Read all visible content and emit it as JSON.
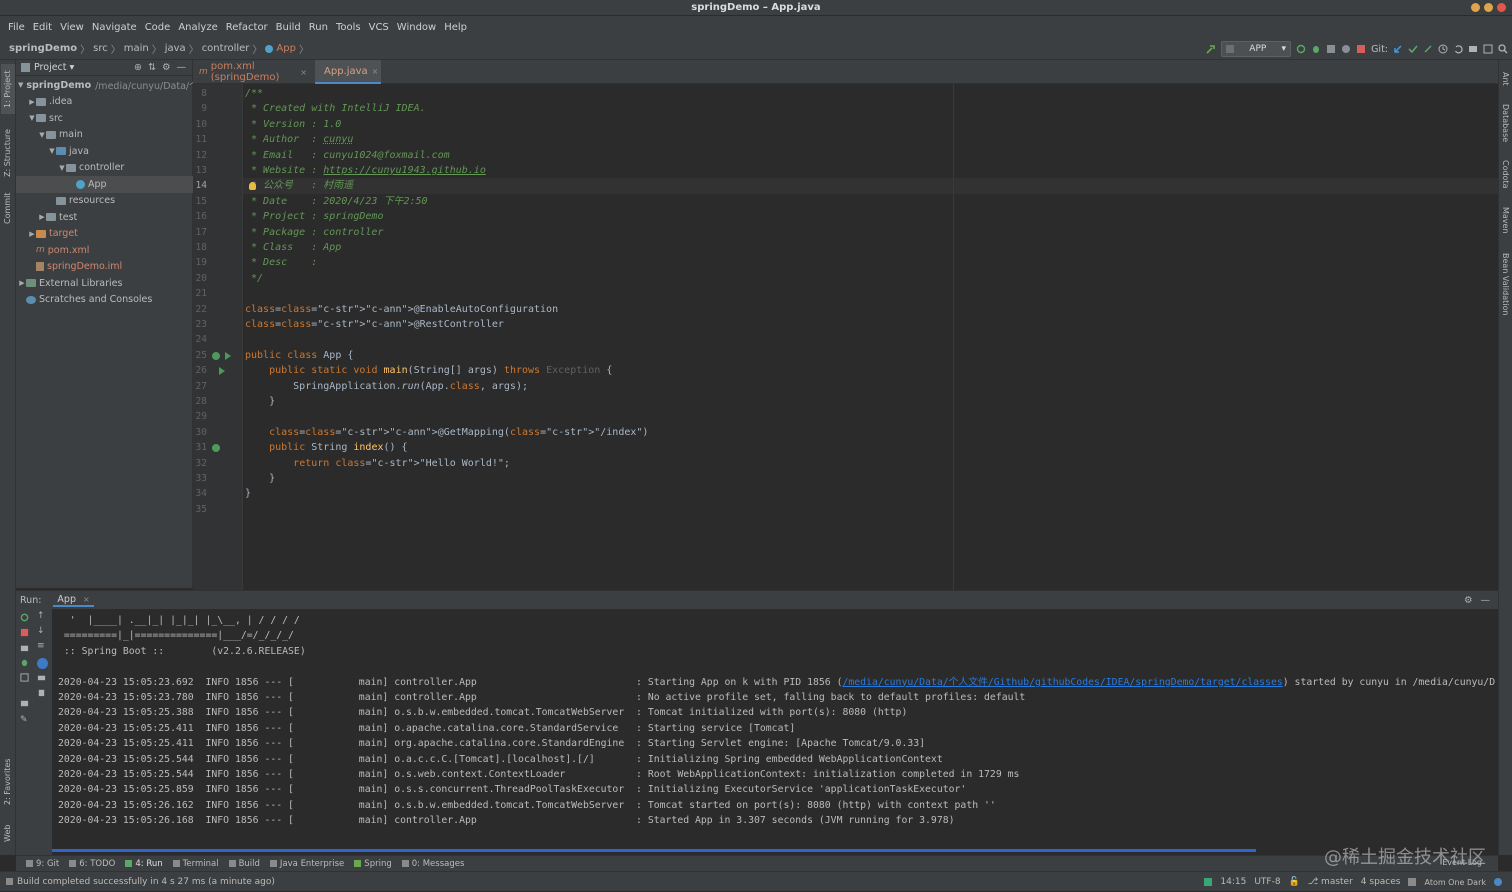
{
  "window": {
    "title": "springDemo – App.java"
  },
  "menu": [
    "File",
    "Edit",
    "View",
    "Navigate",
    "Code",
    "Analyze",
    "Refactor",
    "Build",
    "Run",
    "Tools",
    "VCS",
    "Window",
    "Help"
  ],
  "breadcrumb": [
    "springDemo",
    "src",
    "main",
    "java",
    "controller",
    "App"
  ],
  "toolbar": {
    "run_config": "APP",
    "git_label": "Git:"
  },
  "left_strip": {
    "project": "1: Project",
    "structure": "Z: Structure",
    "commit": "Commit",
    "favorites": "2: Favorites",
    "web": "Web"
  },
  "right_strip": {
    "ant": "Ant",
    "database": "Database",
    "codota": "Codota",
    "maven": "Maven",
    "bean": "Bean Validation"
  },
  "project": {
    "header": "Project",
    "tree": [
      {
        "label": "springDemo",
        "extra": "/media/cunyu/Data/个人",
        "depth": 0,
        "type": "module"
      },
      {
        "label": ".idea",
        "depth": 1,
        "type": "folder"
      },
      {
        "label": "src",
        "depth": 1,
        "type": "folder"
      },
      {
        "label": "main",
        "depth": 2,
        "type": "folder"
      },
      {
        "label": "java",
        "depth": 3,
        "type": "folder-blue"
      },
      {
        "label": "controller",
        "depth": 4,
        "type": "folder"
      },
      {
        "label": "App",
        "depth": 5,
        "type": "class"
      },
      {
        "label": "resources",
        "depth": 3,
        "type": "folder"
      },
      {
        "label": "test",
        "depth": 2,
        "type": "folder"
      },
      {
        "label": "target",
        "depth": 1,
        "type": "folder-orange"
      },
      {
        "label": "pom.xml",
        "depth": 1,
        "type": "maven"
      },
      {
        "label": "springDemo.iml",
        "depth": 1,
        "type": "iml"
      },
      {
        "label": "External Libraries",
        "depth": 0,
        "type": "lib"
      },
      {
        "label": "Scratches and Consoles",
        "depth": 0,
        "type": "scratch"
      }
    ]
  },
  "tabs": [
    {
      "icon": "m",
      "label": "pom.xml (springDemo)"
    },
    {
      "icon": "class",
      "label": "App.java"
    }
  ],
  "editor": {
    "line_numbers": [
      "8",
      "9",
      "10",
      "11",
      "12",
      "13",
      "14",
      "15",
      "16",
      "17",
      "18",
      "19",
      "20",
      "21",
      "22",
      "23",
      "24",
      "25",
      "26",
      "27",
      "28",
      "29",
      "30",
      "31",
      "32",
      "33",
      "34",
      "35"
    ],
    "current_line": "14",
    "lines": [
      "/**",
      " * Created with IntelliJ IDEA.",
      " * Version : 1.0",
      " * Author  : cunyu",
      " * Email   : cunyu1024@foxmail.com",
      " * Website : https://cunyu1943.github.io",
      " * 公众号   : 村雨遥",
      " * Date    : 2020/4/23 下午2:50",
      " * Project : springDemo",
      " * Package : controller",
      " * Class   : App",
      " * Desc    :",
      " */",
      "",
      "@EnableAutoConfiguration",
      "@RestController",
      "",
      "public class App {",
      "    public static void main(String[] args) throws Exception {",
      "        SpringApplication.run(App.class, args);",
      "    }",
      "",
      "    @GetMapping(\"/index\")",
      "    public String index() {",
      "        return \"Hello World!\";",
      "    }",
      "}",
      ""
    ]
  },
  "run": {
    "label": "Run:",
    "tab": "App",
    "console": [
      "  '  |____| .__|_| |_|_| |_\\__, | / / / /",
      " =========|_|==============|___/=/_/_/_/",
      " :: Spring Boot ::        (v2.2.6.RELEASE)",
      "",
      "2020-04-23 15:05:23.692  INFO 1856 --- [           main] controller.App                           : Starting App on k with PID 1856 (",
      "2020-04-23 15:05:23.780  INFO 1856 --- [           main] controller.App                           : No active profile set, falling back to default profiles: default",
      "2020-04-23 15:05:25.388  INFO 1856 --- [           main] o.s.b.w.embedded.tomcat.TomcatWebServer  : Tomcat initialized with port(s): 8080 (http)",
      "2020-04-23 15:05:25.411  INFO 1856 --- [           main] o.apache.catalina.core.StandardService   : Starting service [Tomcat]",
      "2020-04-23 15:05:25.411  INFO 1856 --- [           main] org.apache.catalina.core.StandardEngine  : Starting Servlet engine: [Apache Tomcat/9.0.33]",
      "2020-04-23 15:05:25.544  INFO 1856 --- [           main] o.a.c.c.C.[Tomcat].[localhost].[/]       : Initializing Spring embedded WebApplicationContext",
      "2020-04-23 15:05:25.544  INFO 1856 --- [           main] o.s.web.context.ContextLoader            : Root WebApplicationContext: initialization completed in 1729 ms",
      "2020-04-23 15:05:25.859  INFO 1856 --- [           main] o.s.s.concurrent.ThreadPoolTaskExecutor  : Initializing ExecutorService 'applicationTaskExecutor'",
      "2020-04-23 15:05:26.162  INFO 1856 --- [           main] o.s.b.w.embedded.tomcat.TomcatWebServer  : Tomcat started on port(s): 8080 (http) with context path ''",
      "2020-04-23 15:05:26.168  INFO 1856 --- [           main] controller.App                           : Started App in 3.307 seconds (JVM running for 3.978)"
    ],
    "first_line_link": "/media/cunyu/Data/个人文件/Github/githubCodes/IDEA/springDemo/target/classes",
    "first_line_tail": " started by cunyu in /media/cunyu/D"
  },
  "bottom_tabs": [
    "9: Git",
    "6: TODO",
    "4: Run",
    "Terminal",
    "Build",
    "Java Enterprise",
    "Spring",
    "0: Messages"
  ],
  "event_log": "Event Log",
  "status": {
    "message": "Build completed successfully in 4 s 27 ms (a minute ago)",
    "position": "14:15",
    "encoding": "UTF-8",
    "branch": "master",
    "indent": "4 spaces",
    "theme": "Atom One Dark"
  },
  "watermark": "@稀土掘金技术社区",
  "colors": {
    "accent": "#4a88c7",
    "background": "#2b2b2b",
    "panel": "#3c3f41"
  }
}
